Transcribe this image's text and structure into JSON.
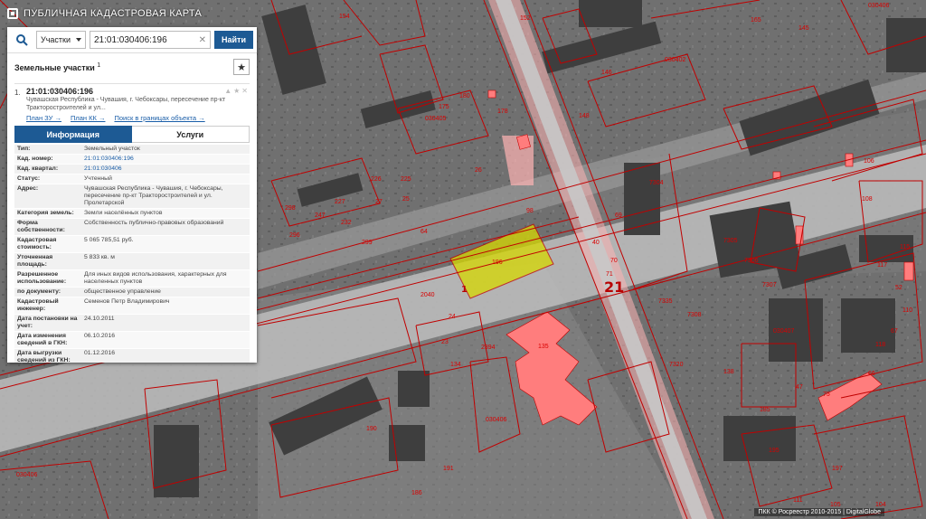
{
  "app": {
    "title": "ПУБЛИЧНАЯ КАДАСТРОВАЯ КАРТА"
  },
  "search": {
    "type_label": "Участки",
    "query": "21:01:030406:196",
    "find_button": "Найти"
  },
  "results": {
    "title": "Земельные участки",
    "count": "1"
  },
  "parcel": {
    "index": "1.",
    "number": "21:01:030406:196",
    "address_short": "Чувашская Республика - Чувашия, г. Чебоксары, пересечение пр-кт Тракторостроителей и ул...",
    "links": [
      "План ЗУ →",
      "План КК →",
      "Поиск в границах объекта →"
    ],
    "tabs": [
      "Информация",
      "Услуги"
    ],
    "info": [
      {
        "key": "Тип:",
        "value": "Земельный участок"
      },
      {
        "key": "Кад. номер:",
        "value": "21:01:030406:196"
      },
      {
        "key": "Кад. квартал:",
        "value": "21:01:030406"
      },
      {
        "key": "Статус:",
        "value": "Учтенный"
      },
      {
        "key": "Адрес:",
        "value": "Чувашская Республика - Чувашия, г. Чебоксары, пересечение пр-кт Тракторостроителей и ул. Пролетарской"
      },
      {
        "key": "Категория земель:",
        "value": "Земли населённых пунктов"
      },
      {
        "key": "Форма собственности:",
        "value": "Собственность публично-правовых образований"
      },
      {
        "key": "Кадастровая стоимость:",
        "value": "5 065 785,51 руб."
      },
      {
        "key": "Уточненная площадь:",
        "value": "5 833 кв. м"
      },
      {
        "key": "Разрешенное использование:",
        "value": "Для иных видов использования, характерных для населенных пунктов"
      },
      {
        "key": "по документу:",
        "value": "общественное управление"
      },
      {
        "key": "Кадастровый инженер:",
        "value": "Семенов Петр Владимирович"
      },
      {
        "key": "Дата постановки на учет:",
        "value": "24.10.2011"
      },
      {
        "key": "Дата изменения сведений в ГКН:",
        "value": "06.10.2016"
      },
      {
        "key": "Дата выгрузки сведений из ГКН:",
        "value": "01.12.2016"
      }
    ]
  },
  "map": {
    "labels": [
      "030402",
      "030405",
      "030406",
      "030407",
      "030406",
      "030406",
      "2",
      "21",
      "1",
      "196",
      "98",
      "40",
      "70",
      "26",
      "180",
      "178",
      "175",
      "148",
      "146",
      "152",
      "154",
      "7304",
      "7305",
      "7306",
      "7307",
      "7308",
      "7320",
      "7335",
      "134",
      "135",
      "2040",
      "2394",
      "191",
      "186",
      "190",
      "138",
      "118",
      "117",
      "106",
      "108",
      "115",
      "110",
      "195",
      "197",
      "66",
      "67",
      "69",
      "71",
      "75",
      "185",
      "165",
      "145",
      "64",
      "225",
      "226",
      "227",
      "247",
      "296",
      "299",
      "232",
      "298",
      "23",
      "24",
      "25",
      "27",
      "47",
      "52",
      "104",
      "105",
      "111"
    ],
    "colors": {
      "parcel_outline": "#c00000",
      "selected_fill": "#d7d800",
      "building_fill": "#ff7d7d",
      "road_zone": "#ffb4b4"
    }
  },
  "footer": {
    "copyright": "ПКК © Росреестр 2010-2015 | DigitalGlobe"
  }
}
